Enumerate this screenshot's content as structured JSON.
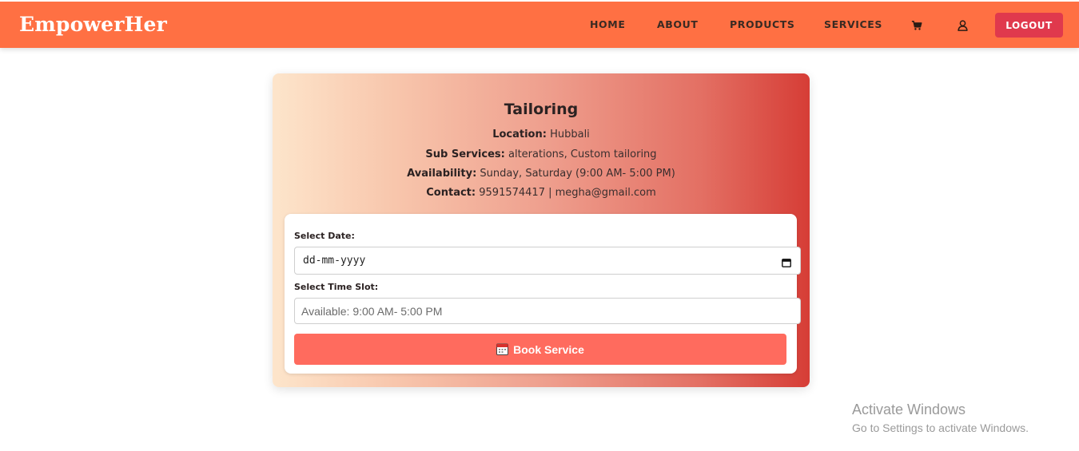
{
  "header": {
    "brand": "EmpowerHer",
    "nav": {
      "home": "HOME",
      "about": "ABOUT",
      "products": "PRODUCTS",
      "services": "SERVICES"
    },
    "icons": {
      "cart": "cart-icon",
      "profile": "user-icon"
    },
    "logout_label": "LOGOUT"
  },
  "service": {
    "title": "Tailoring",
    "location_label": "Location:",
    "location": "Hubbali",
    "sub_services_label": "Sub Services:",
    "sub_services": "alterations, Custom tailoring",
    "availability_label": "Availability:",
    "availability": "Sunday, Saturday (9:00 AM- 5:00 PM)",
    "contact_label": "Contact:",
    "contact": "9591574417 | megha@gmail.com"
  },
  "booking": {
    "date_label": "Select Date:",
    "date_value": "dd-mm-yyyy",
    "time_label": "Select Time Slot:",
    "time_placeholder": "Available: 9:00 AM- 5:00 PM",
    "book_label": "Book Service",
    "book_icon": "calendar-icon"
  },
  "watermark": {
    "title": "Activate Windows",
    "subtitle": "Go to Settings to activate Windows."
  },
  "colors": {
    "header": "#ff7043",
    "logout": "#e0394d",
    "book_button": "#ff6b5e",
    "card_gradient_start": "#fde5cb",
    "card_gradient_end": "#d63d36"
  }
}
